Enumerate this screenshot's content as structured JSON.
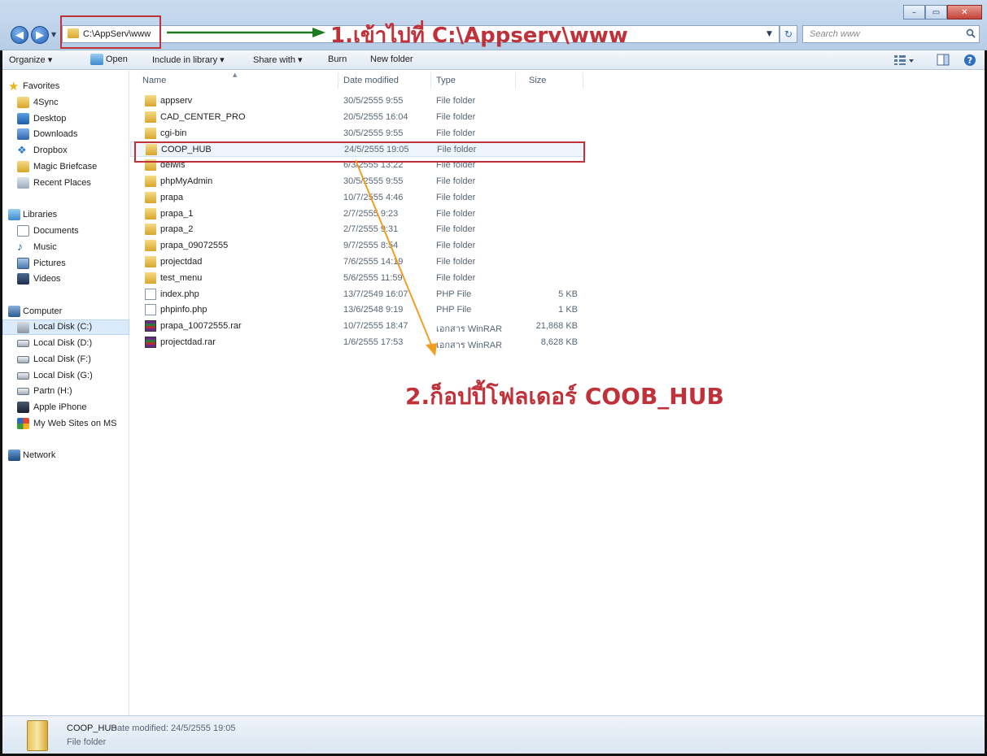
{
  "window": {
    "minimize_glyph": "–",
    "maximize_glyph": "▭",
    "close_glyph": "✕"
  },
  "address": {
    "path": "C:\\AppServ\\www",
    "search_placeholder": "Search www"
  },
  "toolbar": {
    "organize": "Organize ▾",
    "open": "Open",
    "include_in_library": "Include in library ▾",
    "share_with": "Share with ▾",
    "burn": "Burn",
    "new_folder": "New folder"
  },
  "sidebar": {
    "favorites": "Favorites",
    "fav_items": [
      "4Sync",
      "Desktop",
      "Downloads",
      "Dropbox",
      "Magic Briefcase",
      "Recent Places"
    ],
    "libraries": "Libraries",
    "lib_items": [
      "Documents",
      "Music",
      "Pictures",
      "Videos"
    ],
    "computer": "Computer",
    "comp_items": [
      "Local Disk (C:)",
      "Local Disk (D:)",
      "Local Disk (F:)",
      "Local Disk (G:)",
      "Partn (H:)",
      "Apple iPhone",
      "My Web Sites on MS"
    ],
    "network": "Network"
  },
  "columns": {
    "name": "Name",
    "date": "Date modified",
    "type": "Type",
    "size": "Size"
  },
  "files": [
    {
      "name": "appserv",
      "date": "30/5/2555 9:55",
      "type": "File folder",
      "size": "",
      "kind": "folder"
    },
    {
      "name": "CAD_CENTER_PRO",
      "date": "20/5/2555 16:04",
      "type": "File folder",
      "size": "",
      "kind": "folder"
    },
    {
      "name": "cgi-bin",
      "date": "30/5/2555 9:55",
      "type": "File folder",
      "size": "",
      "kind": "folder"
    },
    {
      "name": "COOP_HUB",
      "date": "24/5/2555 19:05",
      "type": "File folder",
      "size": "",
      "kind": "folder"
    },
    {
      "name": "delwis",
      "date": "6/3/2555 13:22",
      "type": "File folder",
      "size": "",
      "kind": "folder"
    },
    {
      "name": "phpMyAdmin",
      "date": "30/5/2555 9:55",
      "type": "File folder",
      "size": "",
      "kind": "folder"
    },
    {
      "name": "prapa",
      "date": "10/7/2555 4:46",
      "type": "File folder",
      "size": "",
      "kind": "folder"
    },
    {
      "name": "prapa_1",
      "date": "2/7/2555 9:23",
      "type": "File folder",
      "size": "",
      "kind": "folder"
    },
    {
      "name": "prapa_2",
      "date": "2/7/2555 9:31",
      "type": "File folder",
      "size": "",
      "kind": "folder"
    },
    {
      "name": "prapa_09072555",
      "date": "9/7/2555 8:54",
      "type": "File folder",
      "size": "",
      "kind": "folder"
    },
    {
      "name": "projectdad",
      "date": "7/6/2555 14:19",
      "type": "File folder",
      "size": "",
      "kind": "folder"
    },
    {
      "name": "test_menu",
      "date": "5/6/2555 11:59",
      "type": "File folder",
      "size": "",
      "kind": "folder"
    },
    {
      "name": "index.php",
      "date": "13/7/2549 16:07",
      "type": "PHP File",
      "size": "5 KB",
      "kind": "file"
    },
    {
      "name": "phpinfo.php",
      "date": "13/6/2548 9:19",
      "type": "PHP File",
      "size": "1 KB",
      "kind": "file"
    },
    {
      "name": "prapa_10072555.rar",
      "date": "10/7/2555 18:47",
      "type": "เอกสาร WinRAR",
      "size": "21,868 KB",
      "kind": "rar"
    },
    {
      "name": "projectdad.rar",
      "date": "1/6/2555 17:53",
      "type": "เอกสาร WinRAR",
      "size": "8,628 KB",
      "kind": "rar"
    }
  ],
  "annotations": {
    "step1": "1.เข้าไปที่ C:\\Appserv\\www",
    "step2": "2.ก็อปปี้โฟลเดอร์ COOB_HUB",
    "box_color": "#c0313a",
    "arrow1_color": "#1e7a1e",
    "arrow2_color": "#f0a020"
  },
  "details": {
    "name": "COOP_HUB",
    "date": "Date modified: 24/5/2555 19:05",
    "type": "File folder"
  }
}
